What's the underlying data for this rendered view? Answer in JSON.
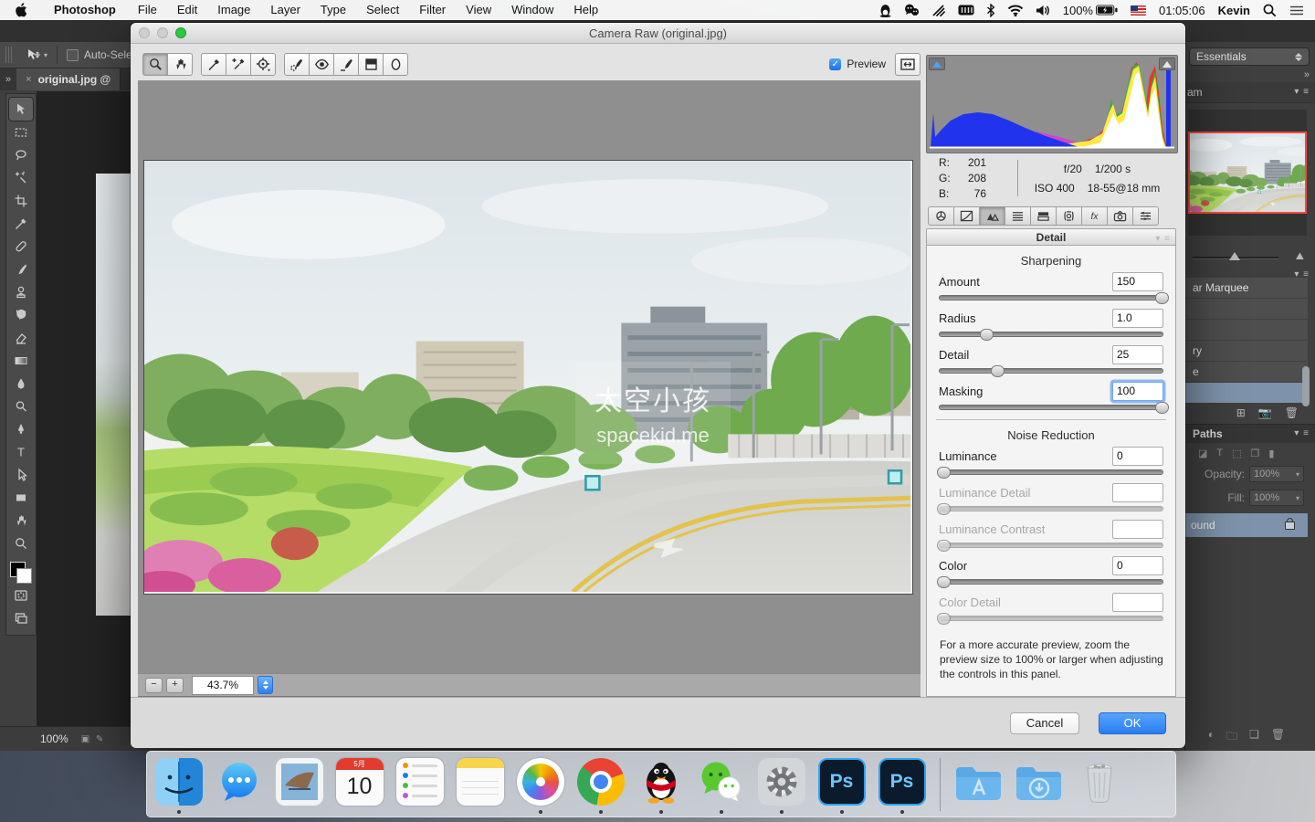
{
  "menubar": {
    "app_menus": [
      "Photoshop",
      "File",
      "Edit",
      "Image",
      "Layer",
      "Type",
      "Select",
      "Filter",
      "View",
      "Window",
      "Help"
    ],
    "status_icons": [
      "qq",
      "wechat",
      "signal",
      "keyboard",
      "bluetooth",
      "wifi",
      "volume"
    ],
    "battery": "100%",
    "time": "01:05:06",
    "user": "Kevin"
  },
  "photoshop": {
    "options": {
      "auto_select_label": "Auto-Sele"
    },
    "tab_close": "×",
    "tab_title": "original.jpg @",
    "panel_expand": "»",
    "workspace": "Essentials",
    "nav_tab_partial": "am",
    "tools": [
      "move",
      "marquee",
      "lasso",
      "magic-wand",
      "crop",
      "eyedropper",
      "healing-brush",
      "brush",
      "clone-stamp",
      "history-brush",
      "eraser",
      "gradient",
      "blur",
      "dodge",
      "pen",
      "type",
      "path-selection",
      "shape",
      "hand",
      "zoom"
    ],
    "selected_tool": "move",
    "history_items": [
      {
        "label": "ar Marquee",
        "selected": false
      },
      {
        "label": "",
        "selected": false
      },
      {
        "label": "",
        "selected": false
      },
      {
        "label": "ry",
        "selected": false
      },
      {
        "label": "e",
        "selected": false
      },
      {
        "label": "",
        "selected": true
      }
    ],
    "layers": {
      "paths_tab": "Paths",
      "opacity_label": "Opacity:",
      "opacity_value": "100%",
      "fill_label": "Fill:",
      "fill_value": "100%",
      "background_partial": "ound"
    },
    "status_zoom": "100%"
  },
  "dialog": {
    "title": "Camera Raw (original.jpg)",
    "preview_label": "Preview",
    "tools": [
      "zoom",
      "hand",
      "white-balance",
      "color-sampler",
      "targeted-adjustment",
      "spot-removal",
      "red-eye",
      "adjustment-brush",
      "graduated-filter",
      "radial-filter"
    ],
    "selected_tool": "zoom",
    "tool_groups": [
      2,
      3,
      5
    ],
    "zoom_minus": "−",
    "zoom_plus": "+",
    "zoom_value": "43.7%",
    "watermark": {
      "line1": "太空小孩",
      "line2": "spacekid.me"
    },
    "histogram_info": {
      "rgb": [
        {
          "label": "R:",
          "value": "201"
        },
        {
          "label": "G:",
          "value": "208"
        },
        {
          "label": "B:",
          "value": "76"
        }
      ],
      "aperture": "f/20",
      "shutter": "1/200 s",
      "iso": "ISO 400",
      "lens": "18-55@18 mm"
    },
    "tabs": [
      "basic",
      "tone-curve",
      "detail",
      "hsl-grayscale",
      "split-toning",
      "lens-corrections",
      "effects",
      "camera-calibration",
      "presets"
    ],
    "selected_tab": "detail",
    "panel_title": "Detail",
    "groups": [
      {
        "heading": "Sharpening",
        "sliders": [
          {
            "label": "Amount",
            "value": "150",
            "pos": 99,
            "disabled": false,
            "focused": false
          },
          {
            "label": "Radius",
            "value": "1.0",
            "pos": 21,
            "disabled": false,
            "focused": false
          },
          {
            "label": "Detail",
            "value": "25",
            "pos": 26,
            "disabled": false,
            "focused": false
          },
          {
            "label": "Masking",
            "value": "100",
            "pos": 99,
            "disabled": false,
            "focused": true
          }
        ]
      },
      {
        "heading": "Noise Reduction",
        "sliders": [
          {
            "label": "Luminance",
            "value": "0",
            "pos": 2,
            "disabled": false,
            "focused": false
          },
          {
            "label": "Luminance Detail",
            "value": "",
            "pos": 2,
            "disabled": true,
            "focused": false
          },
          {
            "label": "Luminance Contrast",
            "value": "",
            "pos": 2,
            "disabled": true,
            "focused": false
          },
          {
            "label": "Color",
            "value": "0",
            "pos": 2,
            "disabled": false,
            "focused": false
          },
          {
            "label": "Color Detail",
            "value": "",
            "pos": 2,
            "disabled": true,
            "focused": false
          }
        ]
      }
    ],
    "note": "For a more accurate preview, zoom the preview size to 100% or larger when adjusting the controls in this panel.",
    "cancel_label": "Cancel",
    "ok_label": "OK"
  },
  "dock": {
    "apps": [
      {
        "name": "finder",
        "running": true
      },
      {
        "name": "messages",
        "running": false
      },
      {
        "name": "mail",
        "running": false
      },
      {
        "name": "calendar",
        "running": false,
        "month": "5月",
        "day": "10"
      },
      {
        "name": "reminders",
        "running": false
      },
      {
        "name": "notes",
        "running": false
      },
      {
        "name": "photos",
        "running": true
      },
      {
        "name": "chrome",
        "running": true
      },
      {
        "name": "qq",
        "running": true
      },
      {
        "name": "wechat",
        "running": true
      },
      {
        "name": "settings",
        "running": true
      },
      {
        "name": "photoshop",
        "label": "Ps",
        "running": true
      },
      {
        "name": "photoshop-2",
        "label": "Ps",
        "running": true
      },
      {
        "name": "applications-folder",
        "running": false
      },
      {
        "name": "downloads-folder",
        "running": false
      },
      {
        "name": "trash",
        "running": false
      }
    ]
  }
}
